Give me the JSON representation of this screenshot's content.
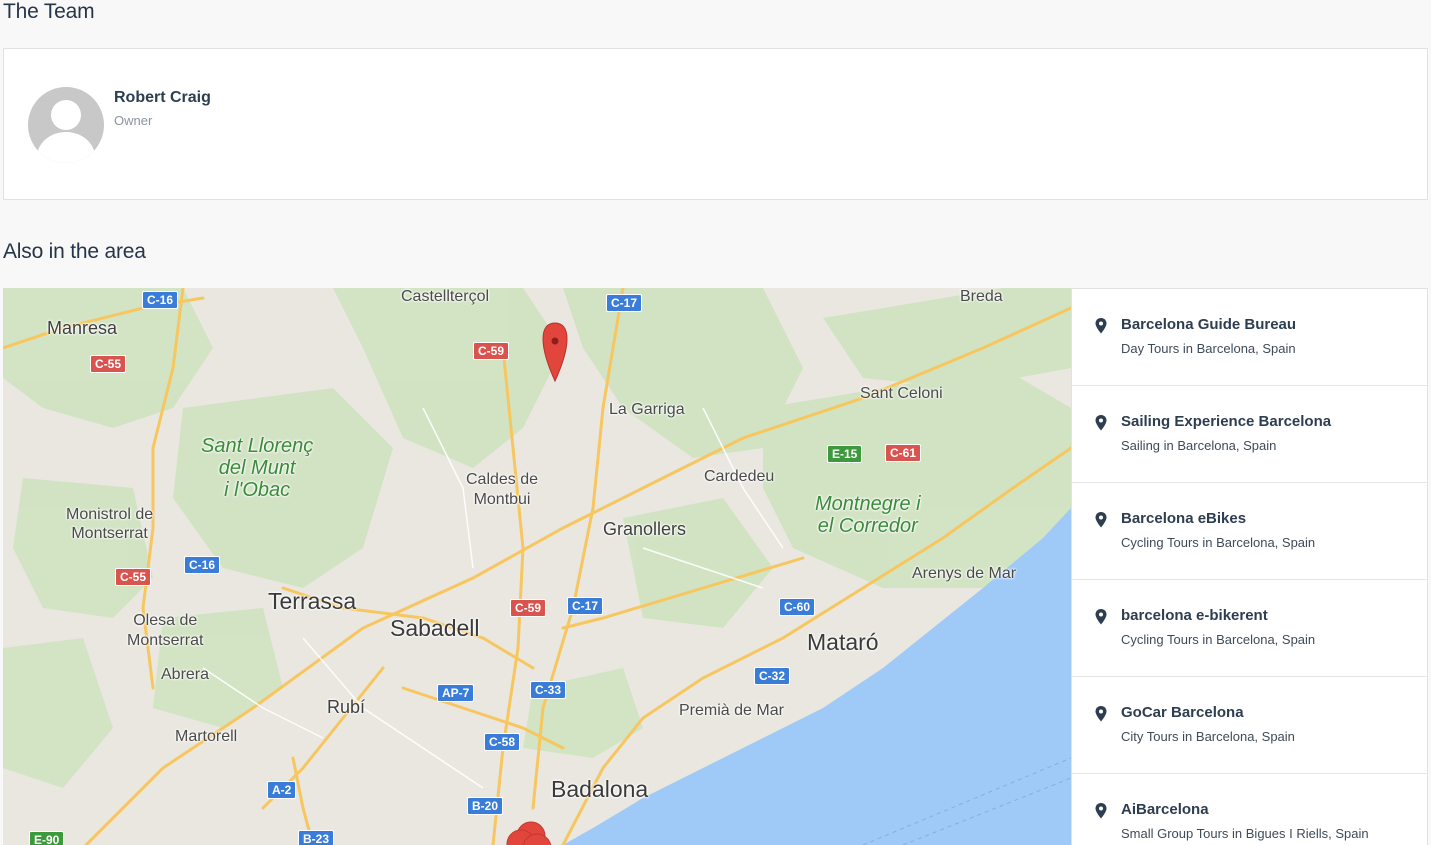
{
  "team": {
    "title": "The Team",
    "members": [
      {
        "name": "Robert Craig",
        "role": "Owner"
      }
    ]
  },
  "area": {
    "title": "Also in the area",
    "map": {
      "cities": {
        "manresa": "Manresa",
        "castellterol": "Castellterçol",
        "breda": "Breda",
        "la_garriga": "La Garriga",
        "sant_celoni": "Sant Celoni",
        "caldes": "Caldes de\nMontbui",
        "cardedeu": "Cardedeu",
        "monistrol": "Monistrol de\nMontserrat",
        "granollers": "Granollers",
        "arenys": "Arenys de Mar",
        "terrassa": "Terrassa",
        "sabadell": "Sabadell",
        "olesa": "Olesa de\nMontserrat",
        "mataro": "Mataró",
        "abrera": "Abrera",
        "rubi": "Rubí",
        "premia": "Premià de Mar",
        "martorell": "Martorell",
        "badalona": "Badalona"
      },
      "parks": {
        "sant_llorenc": "Sant Llorenç\ndel Munt\ni l'Obac",
        "montnegre": "Montnegre i\nel Corredor"
      },
      "roads": {
        "c16a": "C-16",
        "c17a": "C-17",
        "c55a": "C-55",
        "c59a": "C-59",
        "e15": "E-15",
        "c61": "C-61",
        "c16b": "C-16",
        "c55b": "C-55",
        "c59b": "C-59",
        "c17b": "C-17",
        "c60": "C-60",
        "c32": "C-32",
        "ap7": "AP-7",
        "c33": "C-33",
        "c58": "C-58",
        "a2": "A-2",
        "b20": "B-20",
        "e90": "E-90",
        "b23": "B-23"
      }
    },
    "listings": [
      {
        "name": "Barcelona Guide Bureau",
        "subtitle": "Day Tours in Barcelona, Spain"
      },
      {
        "name": "Sailing Experience Barcelona",
        "subtitle": "Sailing in Barcelona, Spain"
      },
      {
        "name": "Barcelona eBikes",
        "subtitle": "Cycling Tours in Barcelona, Spain"
      },
      {
        "name": "barcelona e-bikerent",
        "subtitle": "Cycling Tours in Barcelona, Spain"
      },
      {
        "name": "GoCar Barcelona",
        "subtitle": "City Tours in Barcelona, Spain"
      },
      {
        "name": "AiBarcelona",
        "subtitle": "Small Group Tours in Bigues I Riells, Spain"
      }
    ]
  },
  "colors": {
    "heading": "#26364a",
    "road_blue": "#3a7dd8",
    "road_red": "#d9534f",
    "road_green": "#3c9a3c",
    "sea": "#9fc9f7",
    "marker": "#e2453c"
  }
}
